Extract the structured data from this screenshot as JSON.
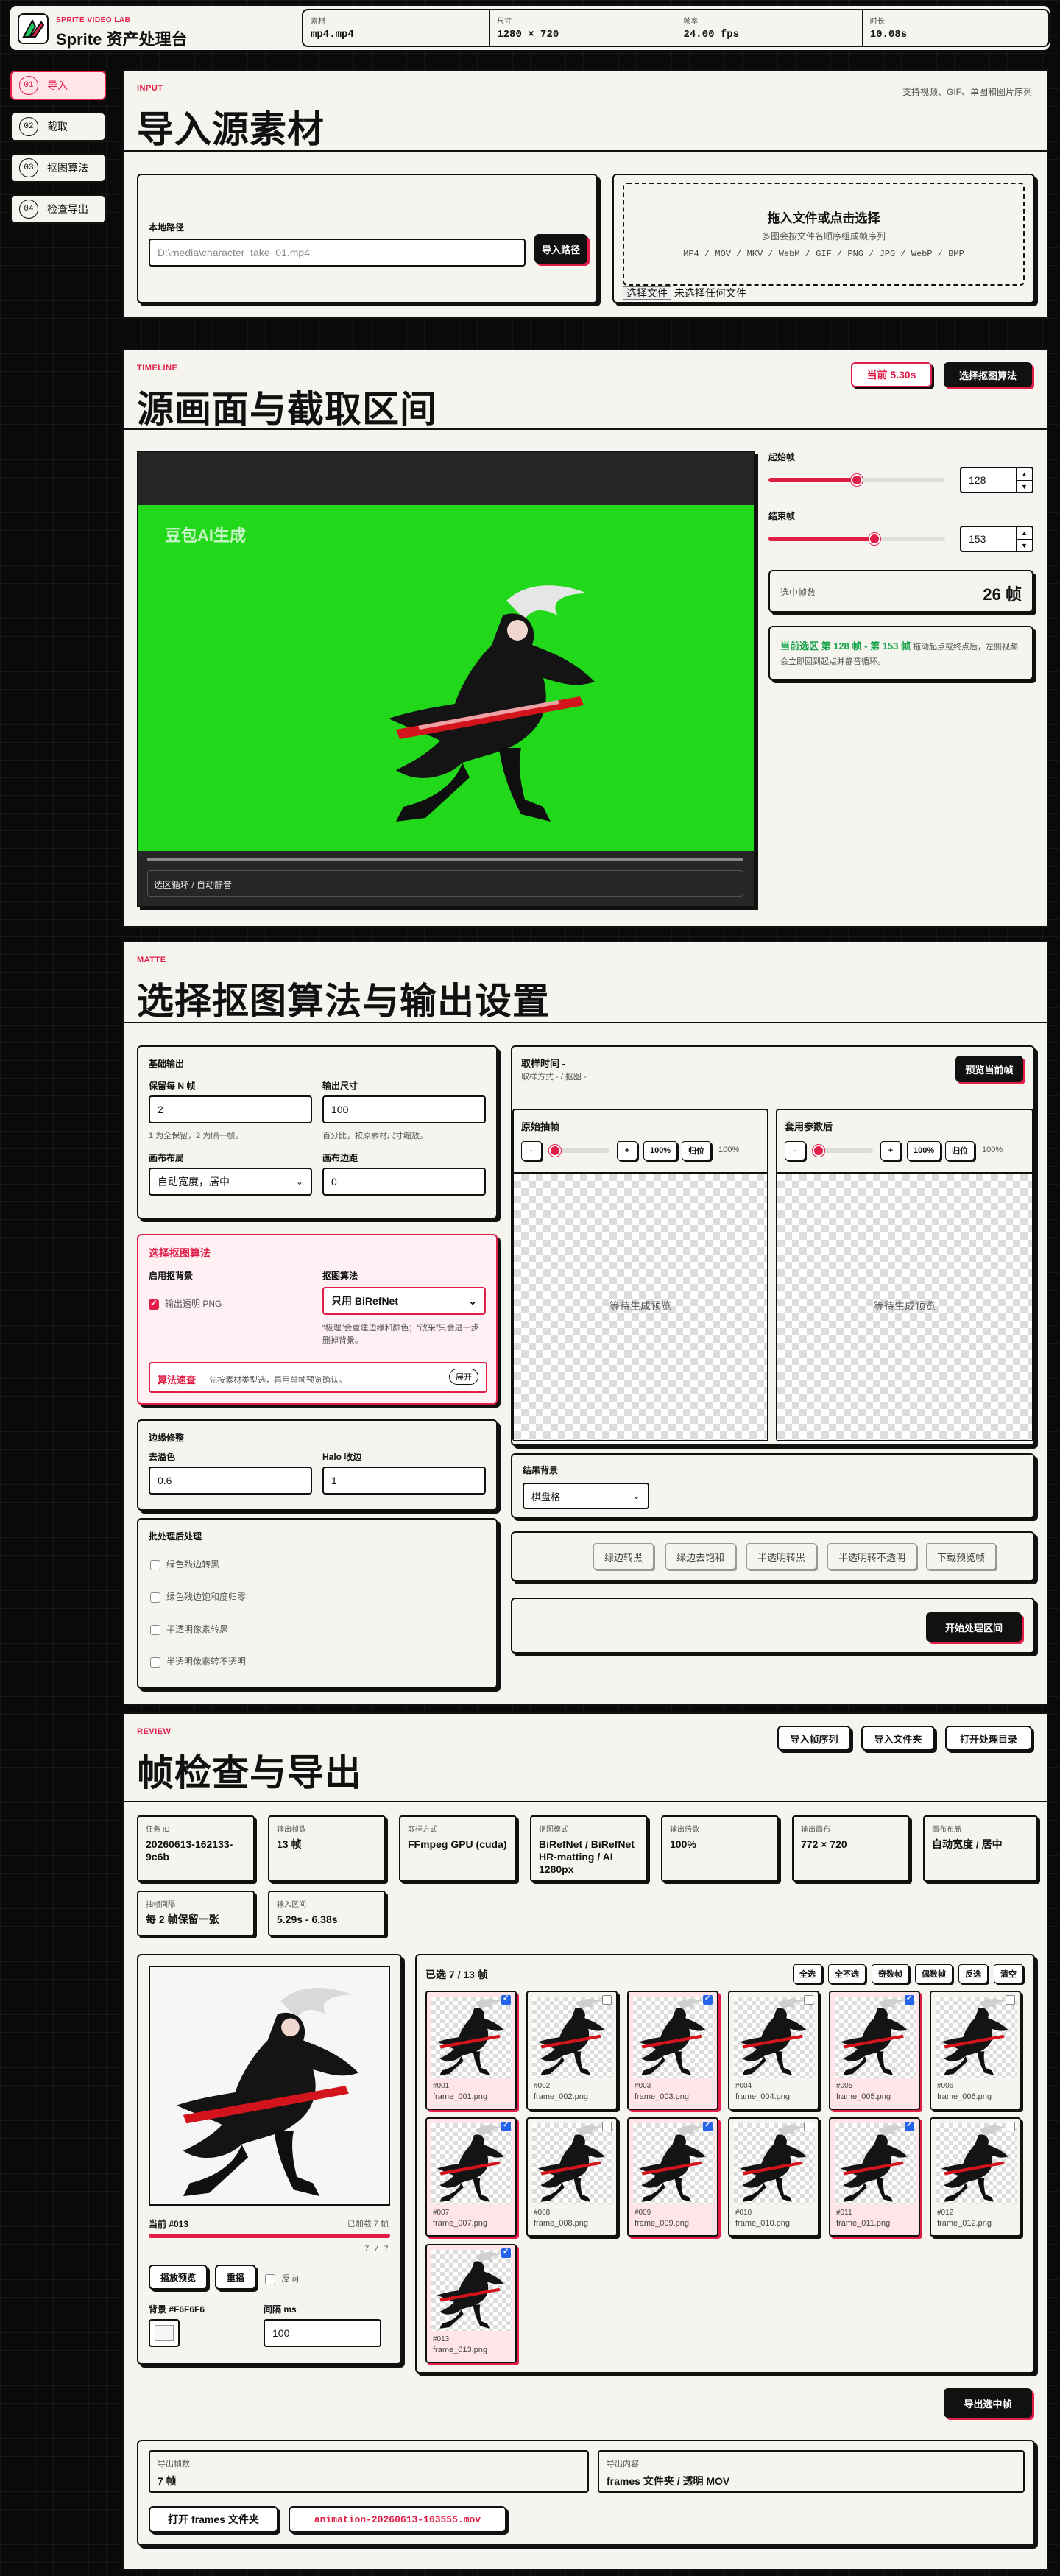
{
  "header": {
    "brand_sub": "SPRITE VIDEO LAB",
    "brand_title": "Sprite 资产处理台",
    "stats": [
      {
        "k": "素材",
        "v": "mp4.mp4"
      },
      {
        "k": "尺寸",
        "v": "1280 × 720"
      },
      {
        "k": "帧率",
        "v": "24.00 fps"
      },
      {
        "k": "时长",
        "v": "10.08s"
      }
    ]
  },
  "sidebar": {
    "items": [
      {
        "num": "01",
        "label": "导入"
      },
      {
        "num": "02",
        "label": "截取"
      },
      {
        "num": "03",
        "label": "抠图算法"
      },
      {
        "num": "04",
        "label": "检查导出"
      }
    ]
  },
  "input": {
    "tag": "INPUT",
    "title": "导入源素材",
    "note": "支持视频、GIF、单图和图片序列",
    "path_label": "本地路径",
    "path_placeholder": "D:\\media\\character_take_01.mp4",
    "import_path_btn": "导入路径",
    "drop_title": "拖入文件或点击选择",
    "drop_sub": "多图会按文件名顺序组成帧序列",
    "drop_formats": "MP4 / MOV / MKV / WebM / GIF / PNG / JPG / WebP / BMP",
    "file_btn": "选择文件",
    "file_none": "未选择任何文件"
  },
  "timeline": {
    "tag": "TIMELINE",
    "title": "源画面与截取区间",
    "current_label": "当前 5.30s",
    "choose_algo_btn": "选择抠图算法",
    "watermark": "豆包AI生成",
    "loop_label": "选区循环 / 自动静音",
    "start_label": "起始帧",
    "start_value": "128",
    "start_pos": 0.5,
    "end_label": "结束帧",
    "end_value": "153",
    "end_pos": 0.6,
    "selected_label": "选中帧数",
    "selected_value": "26 帧",
    "range_text": "当前选区 第 128 帧 - 第 153 帧",
    "range_tip": "拖动起点或终点后，左侧视频会立即回到起点并静音循环。"
  },
  "matte": {
    "tag": "MATTE",
    "title": "选择抠图算法与输出设置",
    "basic_title": "基础输出",
    "keep_n_label": "保留每 N 帧",
    "keep_n_value": "2",
    "keep_n_help": "1 为全保留，2 为隔一帧。",
    "out_size_label": "输出尺寸",
    "out_size_value": "100",
    "out_size_help": "百分比，按原素材尺寸缩放。",
    "layout_label": "画布布局",
    "layout_value": "自动宽度，居中",
    "padding_label": "画布边距",
    "padding_value": "0",
    "algo_title": "选择抠图算法",
    "enable_bg_label": "启用抠背景",
    "transparent_png": "输出透明 PNG",
    "algo_label": "抠图算法",
    "algo_value": "只用 BiRefNet",
    "algo_help": "“极理”会重建边缘和颜色；“改采”只会进一步删掉背景。",
    "quick_read_title": "算法速查",
    "quick_read_text": "先按素材类型选，再用单帧预览确认。",
    "expand_btn": "展开",
    "edge_title": "边缘修整",
    "despill_label": "去溢色",
    "despill_value": "0.6",
    "halo_label": "Halo 收边",
    "halo_value": "1",
    "batch_title": "批处理后处理",
    "batch_items": [
      "绿色残边转黑",
      "绿色残边饱和度归零",
      "半透明像素转黑",
      "半透明像素转不透明"
    ],
    "sample_title": "取样时间 -",
    "sample_sub": "取样方式 - / 抠图 -",
    "preview_btn": "预览当前帧",
    "orig_title": "原始抽帧",
    "after_title": "套用参数后",
    "zoom_value": "100%",
    "zoom_btn": "100%",
    "reset_btn": "归位",
    "zoom_pos": 0.1,
    "waiting": "等待生成预览",
    "result_bg_label": "结果背景",
    "result_bg_value": "棋盘格",
    "action_btns": [
      "绿边转黑",
      "绿边去饱和",
      "半透明转黑",
      "半透明转不透明",
      "下载预览帧"
    ],
    "start_btn": "开始处理区间"
  },
  "review": {
    "tag": "REVIEW",
    "title": "帧检查与导出",
    "btn_import_seq": "导入帧序列",
    "btn_import_folder": "导入文件夹",
    "btn_open_dir": "打开处理目录",
    "info": [
      {
        "k": "任务 ID",
        "v": "20260613-162133-9c6b"
      },
      {
        "k": "输出帧数",
        "v": "13 帧"
      },
      {
        "k": "取样方式",
        "v": "FFmpeg GPU (cuda)"
      },
      {
        "k": "抠图模式",
        "v": "BiRefNet / BiRefNet HR-matting / AI 1280px"
      },
      {
        "k": "输出倍数",
        "v": "100%"
      },
      {
        "k": "输出画布",
        "v": "772 × 720"
      },
      {
        "k": "画布布局",
        "v": "自动宽度 / 居中"
      },
      {
        "k": "抽帧间隔",
        "v": "每 2 帧保留一张"
      },
      {
        "k": "输入区间",
        "v": "5.29s - 6.38s"
      }
    ],
    "current_frame": "当前 #013",
    "loaded": "已加载 7 帧",
    "progress": 1.0,
    "progress_text": "7 / 7",
    "play_btn": "播放预览",
    "replay_btn": "重播",
    "reverse_label": "反向",
    "bg_label": "背景 #F6F6F6",
    "interval_label": "间隔 ms",
    "interval_value": "100",
    "selected_count": "已选 7 / 13 帧",
    "grid_btns": [
      "全选",
      "全不选",
      "奇数帧",
      "偶数帧",
      "反选",
      "清空"
    ],
    "frames": [
      {
        "id": "#001",
        "name": "frame_001.png",
        "sel": true
      },
      {
        "id": "#002",
        "name": "frame_002.png",
        "sel": false
      },
      {
        "id": "#003",
        "name": "frame_003.png",
        "sel": true
      },
      {
        "id": "#004",
        "name": "frame_004.png",
        "sel": false
      },
      {
        "id": "#005",
        "name": "frame_005.png",
        "sel": true
      },
      {
        "id": "#006",
        "name": "frame_006.png",
        "sel": false
      },
      {
        "id": "#007",
        "name": "frame_007.png",
        "sel": true
      },
      {
        "id": "#008",
        "name": "frame_008.png",
        "sel": false
      },
      {
        "id": "#009",
        "name": "frame_009.png",
        "sel": true
      },
      {
        "id": "#010",
        "name": "frame_010.png",
        "sel": false
      },
      {
        "id": "#011",
        "name": "frame_011.png",
        "sel": true
      },
      {
        "id": "#012",
        "name": "frame_012.png",
        "sel": false
      },
      {
        "id": "#013",
        "name": "frame_013.png",
        "sel": true
      }
    ],
    "export_btn": "导出选中帧",
    "export_count_label": "导出帧数",
    "export_count_value": "7 帧",
    "export_content_label": "导出内容",
    "export_content_value": "frames 文件夹 / 透明 MOV",
    "open_frames_btn": "打开 frames 文件夹",
    "mov_name": "animation-20260613-163555.mov"
  },
  "colors": {
    "accent": "#e11d48",
    "ink": "#111111",
    "paper": "#f6f4ee",
    "green": "#22c55e",
    "select_blue": "#2563eb"
  }
}
